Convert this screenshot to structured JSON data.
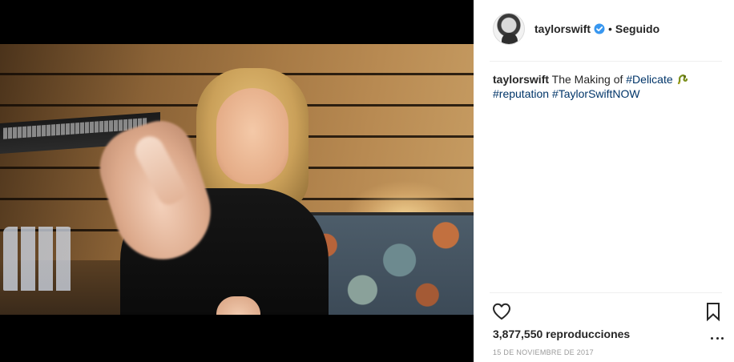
{
  "post": {
    "username": "taylorswift",
    "separator": "•",
    "follow_status": "Seguido",
    "verified_icon": "verified-badge-icon",
    "caption": {
      "username": "taylorswift",
      "text": "The Making of",
      "hashtag_1": "#Delicate",
      "hashtag_2": "#reputation",
      "hashtag_3": "#TaylorSwiftNOW"
    },
    "views": "3,877,550 reproducciones",
    "date": "15 DE NOVIEMBRE DE 2017"
  },
  "icons": {
    "like": "heart-icon",
    "save": "bookmark-icon",
    "more": "more-options-icon"
  },
  "colors": {
    "hashtag": "#003569",
    "verified": "#3897f0",
    "text": "#262626",
    "muted": "#999999",
    "divider": "#efefef"
  }
}
